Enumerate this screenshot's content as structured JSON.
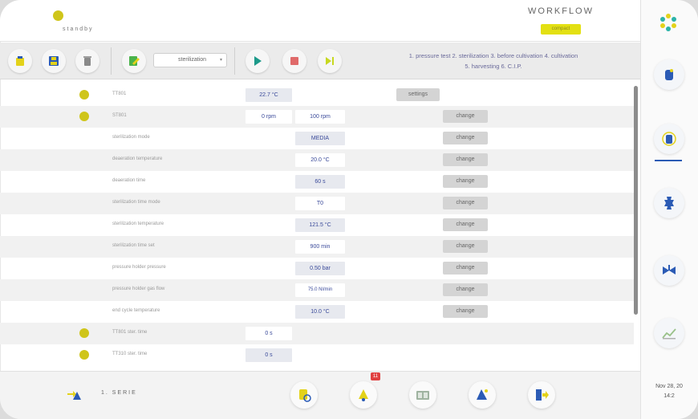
{
  "header": {
    "status": "standby",
    "title": "WORKFLOW",
    "badge": "compact"
  },
  "toolbar": {
    "program_select": "sterilization",
    "phases_line1": "1. pressure test  2. sterilization  3. before cultivation  4. cultivation",
    "phases_line2": "5. harvesting  6. C.I.P."
  },
  "rows": [
    {
      "label": "TT801",
      "v1": "22.7 °C",
      "v2": "",
      "button": "settings"
    },
    {
      "label": "ST801",
      "v1": "0 rpm",
      "v2": "100 rpm",
      "button": "change"
    },
    {
      "label": "sterilization mode",
      "v1": "",
      "v2": "MEDIA",
      "button": "change"
    },
    {
      "label": "deaeration temperature",
      "v1": "",
      "v2": "20.0 °C",
      "button": "change"
    },
    {
      "label": "deaeration time",
      "v1": "",
      "v2": "60 s",
      "button": "change"
    },
    {
      "label": "sterilization time mode",
      "v1": "",
      "v2": "T0",
      "button": "change"
    },
    {
      "label": "sterilization temperature",
      "v1": "",
      "v2": "121.5 °C",
      "button": "change"
    },
    {
      "label": "sterilization time set",
      "v1": "",
      "v2": "900 min",
      "button": "change"
    },
    {
      "label": "pressure holder pressure",
      "v1": "",
      "v2": "0.50 bar",
      "button": "change"
    },
    {
      "label": "pressure holder gas flow",
      "v1": "",
      "v2": "75.0 Nl/min",
      "button": "change"
    },
    {
      "label": "end cycle temperature",
      "v1": "",
      "v2": "10.0 °C",
      "button": "change"
    },
    {
      "label": "TT801 ster. time",
      "v1": "0 s",
      "v2": "",
      "button": ""
    },
    {
      "label": "TT310 ster. time",
      "v1": "0 s",
      "v2": "",
      "button": ""
    }
  ],
  "bottom": {
    "serie": "1. SERIE",
    "notification_count": "11"
  },
  "sidebar": {
    "date": "Nov 28, 20",
    "time": "14:2"
  },
  "colors": {
    "accent_yellow": "#cfc51a",
    "accent_blue": "#2b5bb5",
    "badge_yellow": "#e3e013"
  }
}
